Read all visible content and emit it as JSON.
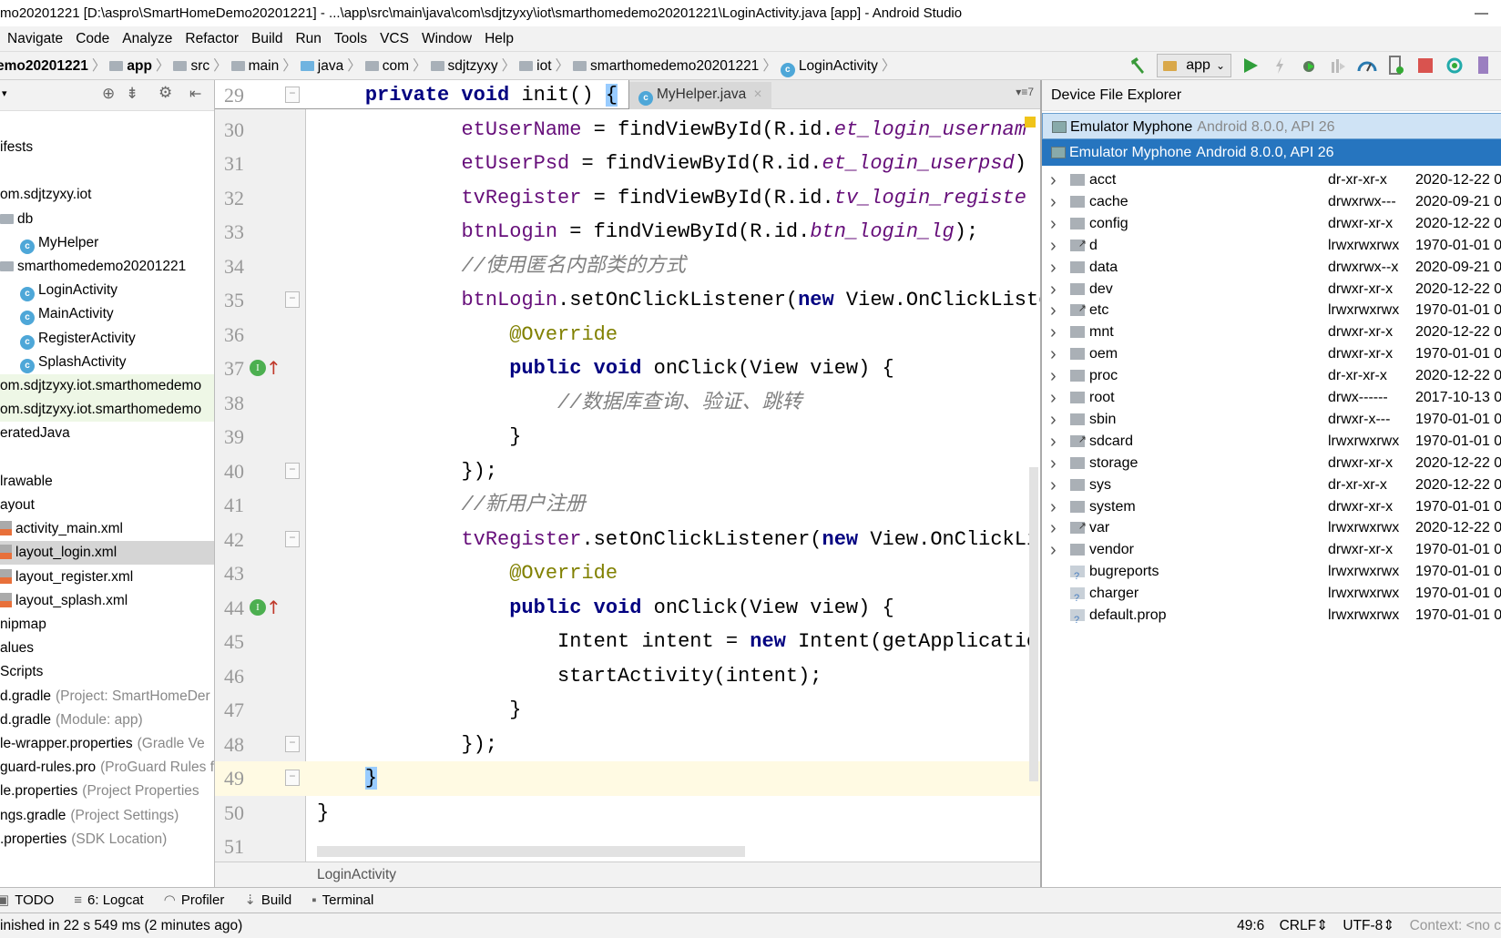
{
  "window": {
    "title": "mo20201221 [D:\\aspro\\SmartHomeDemo20201221] - ...\\app\\src\\main\\java\\com\\sdjtzyxy\\iot\\smarthomedemo20201221\\LoginActivity.java [app] - Android Studio",
    "minimize": "—"
  },
  "menu": [
    "Navigate",
    "Code",
    "Analyze",
    "Refactor",
    "Build",
    "Run",
    "Tools",
    "VCS",
    "Window",
    "Help"
  ],
  "breadcrumb": [
    {
      "label": "emo20201221",
      "icon": "none"
    },
    {
      "label": "app",
      "icon": "module-folder-icon"
    },
    {
      "label": "src",
      "icon": "folder-icon"
    },
    {
      "label": "main",
      "icon": "folder-icon"
    },
    {
      "label": "java",
      "icon": "source-folder-icon"
    },
    {
      "label": "com",
      "icon": "package-icon"
    },
    {
      "label": "sdjtzyxy",
      "icon": "package-icon"
    },
    {
      "label": "iot",
      "icon": "package-icon"
    },
    {
      "label": "smarthomedemo20201221",
      "icon": "package-icon"
    },
    {
      "label": "LoginActivity",
      "icon": "class-icon"
    }
  ],
  "toolbar": {
    "run_config": "app"
  },
  "project_tree": [
    {
      "label": "ifests",
      "indent": 0,
      "icon": "none"
    },
    {
      "label": "",
      "indent": 0,
      "icon": "none"
    },
    {
      "label": "om.sdjtzyxy.iot",
      "indent": 0,
      "icon": "none"
    },
    {
      "label": "db",
      "indent": 1,
      "icon": "folder"
    },
    {
      "label": "MyHelper",
      "indent": 2,
      "icon": "class"
    },
    {
      "label": "smarthomedemo20201221",
      "indent": 1,
      "icon": "folder"
    },
    {
      "label": "LoginActivity",
      "indent": 2,
      "icon": "class"
    },
    {
      "label": "MainActivity",
      "indent": 2,
      "icon": "class"
    },
    {
      "label": "RegisterActivity",
      "indent": 2,
      "icon": "class"
    },
    {
      "label": "SplashActivity",
      "indent": 2,
      "icon": "class"
    },
    {
      "label": "om.sdjtzyxy.iot.smarthomedemo",
      "indent": 0,
      "icon": "none",
      "state": "generated"
    },
    {
      "label": "om.sdjtzyxy.iot.smarthomedemo",
      "indent": 0,
      "icon": "none",
      "state": "generated"
    },
    {
      "label": "eratedJava",
      "indent": 0,
      "icon": "none"
    },
    {
      "label": "",
      "indent": 0,
      "icon": "none"
    },
    {
      "label": "lrawable",
      "indent": 0,
      "icon": "none"
    },
    {
      "label": "ayout",
      "indent": 0,
      "icon": "none"
    },
    {
      "label": "activity_main.xml",
      "indent": 1,
      "icon": "xml"
    },
    {
      "label": "layout_login.xml",
      "indent": 1,
      "icon": "xml",
      "state": "selected"
    },
    {
      "label": "layout_register.xml",
      "indent": 1,
      "icon": "xml"
    },
    {
      "label": "layout_splash.xml",
      "indent": 1,
      "icon": "xml"
    },
    {
      "label": "nipmap",
      "indent": 0,
      "icon": "none"
    },
    {
      "label": "alues",
      "indent": 0,
      "icon": "none"
    },
    {
      "label": "Scripts",
      "indent": 0,
      "icon": "none"
    },
    {
      "label": "d.gradle",
      "hint": "(Project: SmartHomeDer",
      "indent": 0,
      "icon": "none"
    },
    {
      "label": "d.gradle",
      "hint": "(Module: app)",
      "indent": 0,
      "icon": "none"
    },
    {
      "label": "le-wrapper.properties",
      "hint": "(Gradle Ve",
      "indent": 0,
      "icon": "none"
    },
    {
      "label": "guard-rules.pro",
      "hint": "(ProGuard Rules f",
      "indent": 0,
      "icon": "none"
    },
    {
      "label": "le.properties",
      "hint": "(Project Properties",
      "indent": 0,
      "icon": "none"
    },
    {
      "label": "ngs.gradle",
      "hint": "(Project Settings)",
      "indent": 0,
      "icon": "none"
    },
    {
      "label": ".properties",
      "hint": "(SDK Location)",
      "indent": 0,
      "icon": "none"
    }
  ],
  "editor": {
    "tabs": [
      {
        "label": "MyHelper.java",
        "close": "×"
      }
    ],
    "tab_overflow": "▾≡7",
    "current_line": 49,
    "lines": [
      {
        "n": 29,
        "t": [
          [
            "    ",
            ""
          ],
          [
            "private void ",
            "kw"
          ],
          [
            "init() ",
            ""
          ],
          [
            "{",
            "brace-hl"
          ]
        ]
      },
      {
        "n": 30,
        "t": [
          [
            "            ",
            ""
          ],
          [
            "etUserName",
            "fld"
          ],
          [
            " = findViewById(R.id.",
            ""
          ],
          [
            "et_login_usernam",
            "fi"
          ]
        ]
      },
      {
        "n": 31,
        "t": [
          [
            "            ",
            ""
          ],
          [
            "etUserPsd",
            "fld"
          ],
          [
            " = findViewById(R.id.",
            ""
          ],
          [
            "et_login_userpsd",
            "fi"
          ],
          [
            ")",
            ""
          ]
        ]
      },
      {
        "n": 32,
        "t": [
          [
            "            ",
            ""
          ],
          [
            "tvRegister",
            "fld"
          ],
          [
            " = findViewById(R.id.",
            ""
          ],
          [
            "tv_login_registe",
            "fi"
          ]
        ]
      },
      {
        "n": 33,
        "t": [
          [
            "            ",
            ""
          ],
          [
            "btnLogin",
            "fld"
          ],
          [
            " = findViewById(R.id.",
            ""
          ],
          [
            "btn_login_lg",
            "fi"
          ],
          [
            ");",
            ""
          ]
        ]
      },
      {
        "n": 34,
        "t": [
          [
            "            ",
            ""
          ],
          [
            "//使用匿名内部类的方式",
            "cm"
          ]
        ]
      },
      {
        "n": 35,
        "t": [
          [
            "            ",
            ""
          ],
          [
            "btnLogin",
            "fld"
          ],
          [
            ".setOnClickListener(",
            ""
          ],
          [
            "new ",
            "kw"
          ],
          [
            "View.OnClickListe",
            ""
          ]
        ]
      },
      {
        "n": 36,
        "t": [
          [
            "                ",
            ""
          ],
          [
            "@Override",
            "an"
          ]
        ]
      },
      {
        "n": 37,
        "t": [
          [
            "                ",
            ""
          ],
          [
            "public void ",
            "kw"
          ],
          [
            "onClick(View view) {",
            ""
          ]
        ]
      },
      {
        "n": 38,
        "t": [
          [
            "                    ",
            ""
          ],
          [
            "//数据库查询、验证、跳转",
            "cm"
          ]
        ]
      },
      {
        "n": 39,
        "t": [
          [
            "                ",
            ""
          ],
          [
            "}",
            ""
          ]
        ]
      },
      {
        "n": 40,
        "t": [
          [
            "            ",
            ""
          ],
          [
            "});",
            ""
          ]
        ]
      },
      {
        "n": 41,
        "t": [
          [
            "            ",
            ""
          ],
          [
            "//新用户注册",
            "cm"
          ]
        ]
      },
      {
        "n": 42,
        "t": [
          [
            "            ",
            ""
          ],
          [
            "tvRegister",
            "fld"
          ],
          [
            ".setOnClickListener(",
            ""
          ],
          [
            "new ",
            "kw"
          ],
          [
            "View.OnClickLi",
            ""
          ]
        ]
      },
      {
        "n": 43,
        "t": [
          [
            "                ",
            ""
          ],
          [
            "@Override",
            "an"
          ]
        ]
      },
      {
        "n": 44,
        "t": [
          [
            "                ",
            ""
          ],
          [
            "public void ",
            "kw"
          ],
          [
            "onClick(View view) {",
            ""
          ]
        ]
      },
      {
        "n": 45,
        "t": [
          [
            "                    ",
            ""
          ],
          [
            "Intent intent = ",
            ""
          ],
          [
            "new ",
            "kw"
          ],
          [
            "Intent(getApplication",
            ""
          ]
        ]
      },
      {
        "n": 46,
        "t": [
          [
            "                    ",
            ""
          ],
          [
            "startActivity(intent);",
            ""
          ]
        ]
      },
      {
        "n": 47,
        "t": [
          [
            "                ",
            ""
          ],
          [
            "}",
            ""
          ]
        ]
      },
      {
        "n": 48,
        "t": [
          [
            "            ",
            ""
          ],
          [
            "});",
            ""
          ]
        ]
      },
      {
        "n": 49,
        "t": [
          [
            "    ",
            ""
          ],
          [
            "}",
            "brace-hl"
          ]
        ]
      },
      {
        "n": 50,
        "t": [
          [
            "}",
            ""
          ]
        ]
      },
      {
        "n": 51,
        "t": []
      }
    ],
    "implements_markers": [
      37,
      44
    ],
    "breadcrumb": "LoginActivity"
  },
  "device_explorer": {
    "title": "Device File Explorer",
    "devices": [
      {
        "name": "Emulator Myphone",
        "detail": "Android 8.0.0, API 26",
        "state": "normal"
      },
      {
        "name": "Emulator Myphone",
        "detail": "Android 8.0.0, API 26",
        "state": "selected"
      }
    ],
    "files": [
      {
        "name": "acct",
        "perm": "dr-xr-xr-x",
        "date": "2020-12-22 0",
        "type": "dir"
      },
      {
        "name": "cache",
        "perm": "drwxrwx---",
        "date": "2020-09-21 0",
        "type": "dir"
      },
      {
        "name": "config",
        "perm": "drwxr-xr-x",
        "date": "2020-12-22 0",
        "type": "dir"
      },
      {
        "name": "d",
        "perm": "lrwxrwxrwx",
        "date": "1970-01-01 0",
        "type": "link"
      },
      {
        "name": "data",
        "perm": "drwxrwx--x",
        "date": "2020-09-21 0",
        "type": "dir"
      },
      {
        "name": "dev",
        "perm": "drwxr-xr-x",
        "date": "2020-12-22 0",
        "type": "dir"
      },
      {
        "name": "etc",
        "perm": "lrwxrwxrwx",
        "date": "1970-01-01 0",
        "type": "link"
      },
      {
        "name": "mnt",
        "perm": "drwxr-xr-x",
        "date": "2020-12-22 0",
        "type": "dir"
      },
      {
        "name": "oem",
        "perm": "drwxr-xr-x",
        "date": "1970-01-01 0",
        "type": "dir"
      },
      {
        "name": "proc",
        "perm": "dr-xr-xr-x",
        "date": "2020-12-22 0",
        "type": "dir"
      },
      {
        "name": "root",
        "perm": "drwx------",
        "date": "2017-10-13 0",
        "type": "dir"
      },
      {
        "name": "sbin",
        "perm": "drwxr-x---",
        "date": "1970-01-01 0",
        "type": "dir"
      },
      {
        "name": "sdcard",
        "perm": "lrwxrwxrwx",
        "date": "1970-01-01 0",
        "type": "link"
      },
      {
        "name": "storage",
        "perm": "drwxr-xr-x",
        "date": "2020-12-22 0",
        "type": "dir"
      },
      {
        "name": "sys",
        "perm": "dr-xr-xr-x",
        "date": "2020-12-22 0",
        "type": "dir"
      },
      {
        "name": "system",
        "perm": "drwxr-xr-x",
        "date": "1970-01-01 0",
        "type": "dir"
      },
      {
        "name": "var",
        "perm": "lrwxrwxrwx",
        "date": "2020-12-22 0",
        "type": "link"
      },
      {
        "name": "vendor",
        "perm": "drwxr-xr-x",
        "date": "1970-01-01 0",
        "type": "dir"
      },
      {
        "name": "bugreports",
        "perm": "lrwxrwxrwx",
        "date": "1970-01-01 0",
        "type": "unknown"
      },
      {
        "name": "charger",
        "perm": "lrwxrwxrwx",
        "date": "1970-01-01 0",
        "type": "unknown"
      },
      {
        "name": "default.prop",
        "perm": "lrwxrwxrwx",
        "date": "1970-01-01 0",
        "type": "unknown"
      }
    ]
  },
  "bottom_tools": [
    {
      "label": "TODO",
      "icon": "todo-icon"
    },
    {
      "label": "6: Logcat",
      "icon": "logcat-icon"
    },
    {
      "label": "Profiler",
      "icon": "profiler-icon"
    },
    {
      "label": "Build",
      "icon": "build-icon"
    },
    {
      "label": "Terminal",
      "icon": "terminal-icon"
    }
  ],
  "status": {
    "message": "inished in 22 s 549 ms (2 minutes ago)",
    "position": "49:6",
    "line_sep": "CRLF⇕",
    "encoding": "UTF-8⇕",
    "context": "Context: <no c"
  },
  "colors": {
    "keyword": "#000080",
    "field": "#660e7a",
    "comment": "#808080",
    "annotation": "#808000",
    "selection": "#2675bf",
    "current_line": "#fffae3"
  }
}
